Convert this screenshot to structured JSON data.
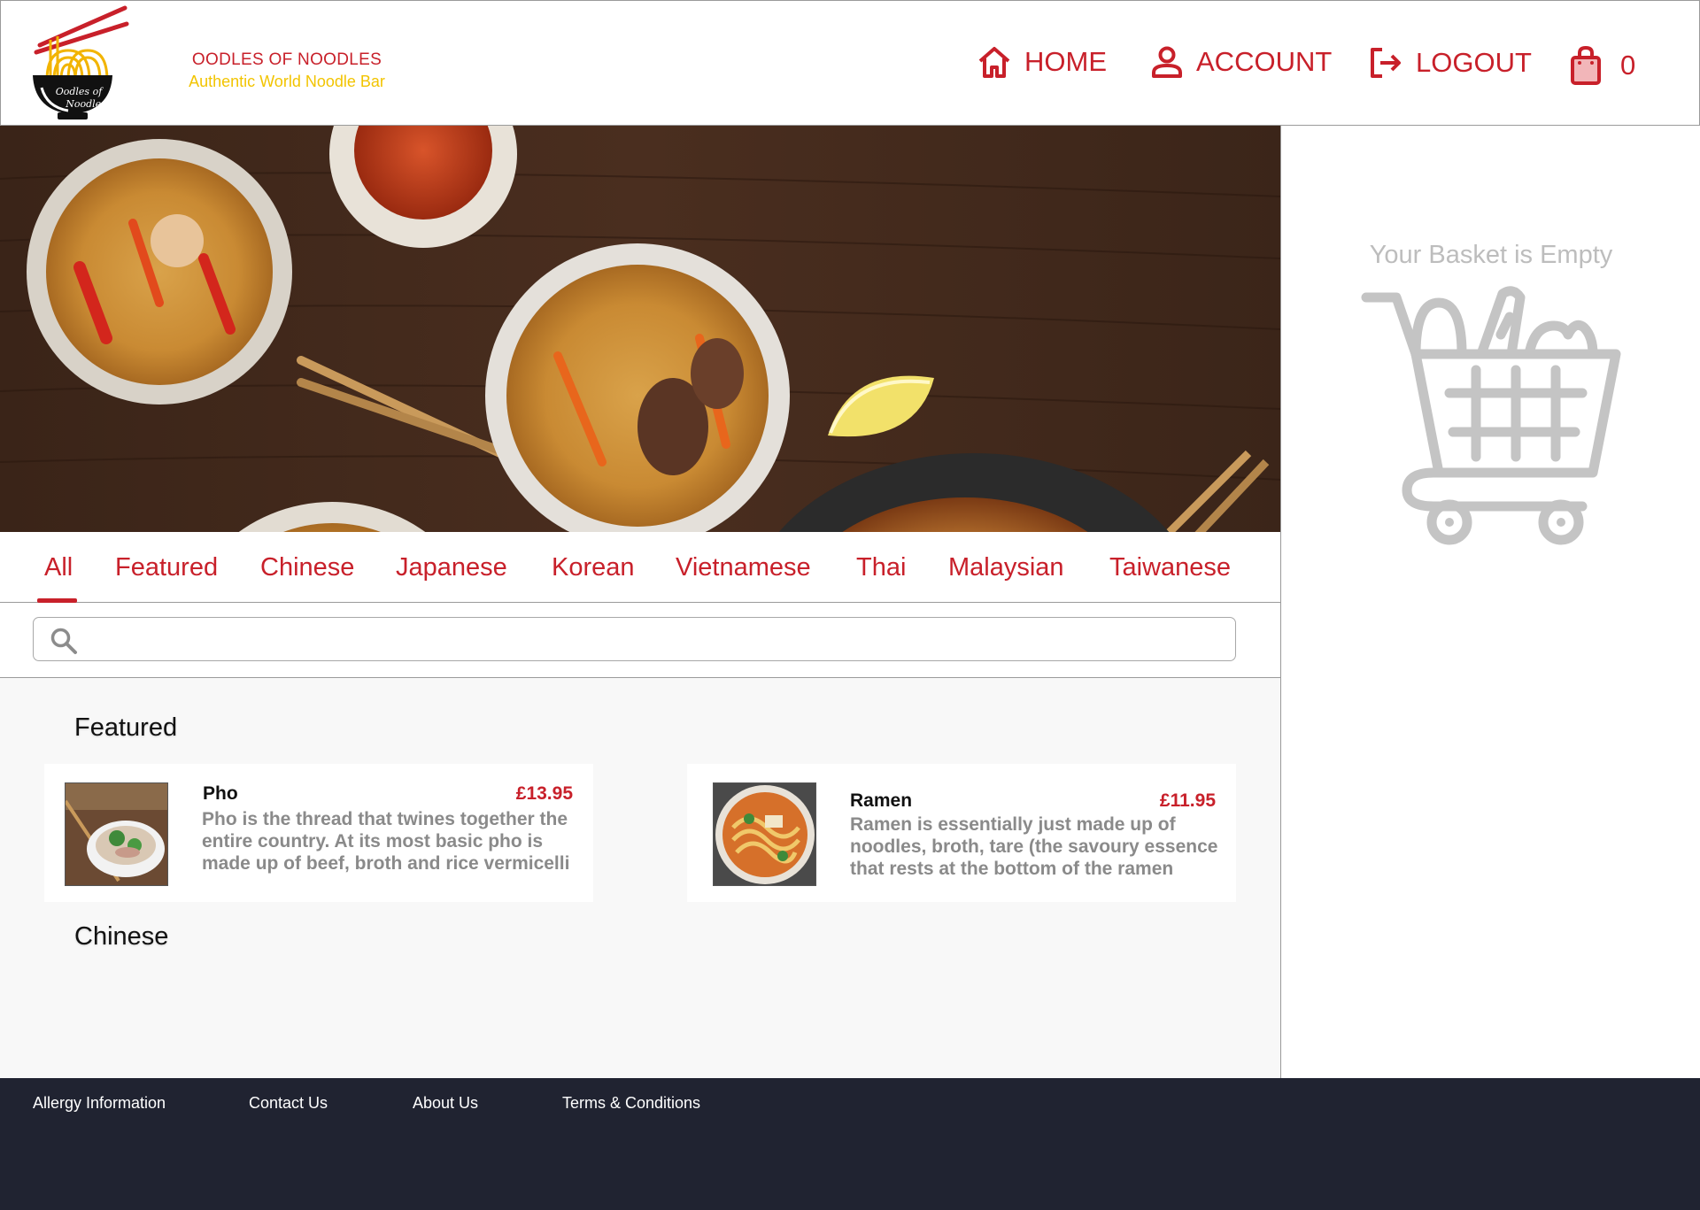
{
  "header": {
    "brand_name": "OODLES OF NOODLES",
    "brand_tagline": "Authentic World Noodle Bar",
    "logo_text_line1": "Oodles of",
    "logo_text_line2": "Noodles",
    "nav": {
      "home_label": "HOME",
      "account_label": "ACCOUNT",
      "logout_label": "LOGOUT",
      "cart_count": "0"
    }
  },
  "hero": {
    "image_subject": "noodle bowls on wooden table",
    "icons": [
      "noodle-bowl",
      "spice-bowl",
      "chopsticks",
      "lemon-wedge",
      "fried-rice-plate"
    ]
  },
  "basket": {
    "empty_message": "Your Basket is Empty",
    "icon": "shopping-cart-icon"
  },
  "tabs": {
    "active": "All",
    "items": [
      "All",
      "Featured",
      "Chinese",
      "Japanese",
      "Korean",
      "Vietnamese",
      "Thai",
      "Malaysian",
      "Taiwanese"
    ]
  },
  "search": {
    "value": "",
    "placeholder": ""
  },
  "menu": {
    "sections": [
      {
        "title": "Featured",
        "items": [
          {
            "name": "Pho",
            "price": "£13.95",
            "description": "Pho is the thread that twines together the entire country. At its most basic pho is made up of beef, broth and rice vermicelli"
          },
          {
            "name": "Ramen",
            "price": "£11.95",
            "description": "Ramen is essentially just made up of noodles, broth, tare (the savoury essence that rests at the bottom of the ramen"
          }
        ]
      },
      {
        "title": "Chinese",
        "items": []
      }
    ]
  },
  "footer": {
    "links": [
      "Allergy Information",
      "Contact Us",
      "About Us",
      "Terms & Conditions"
    ]
  },
  "colors": {
    "brand_red": "#c8202a",
    "brand_yellow": "#f2c400",
    "footer_bg": "#202331",
    "muted_text": "#8a8a8a",
    "basket_grey": "#bdbdbd"
  }
}
